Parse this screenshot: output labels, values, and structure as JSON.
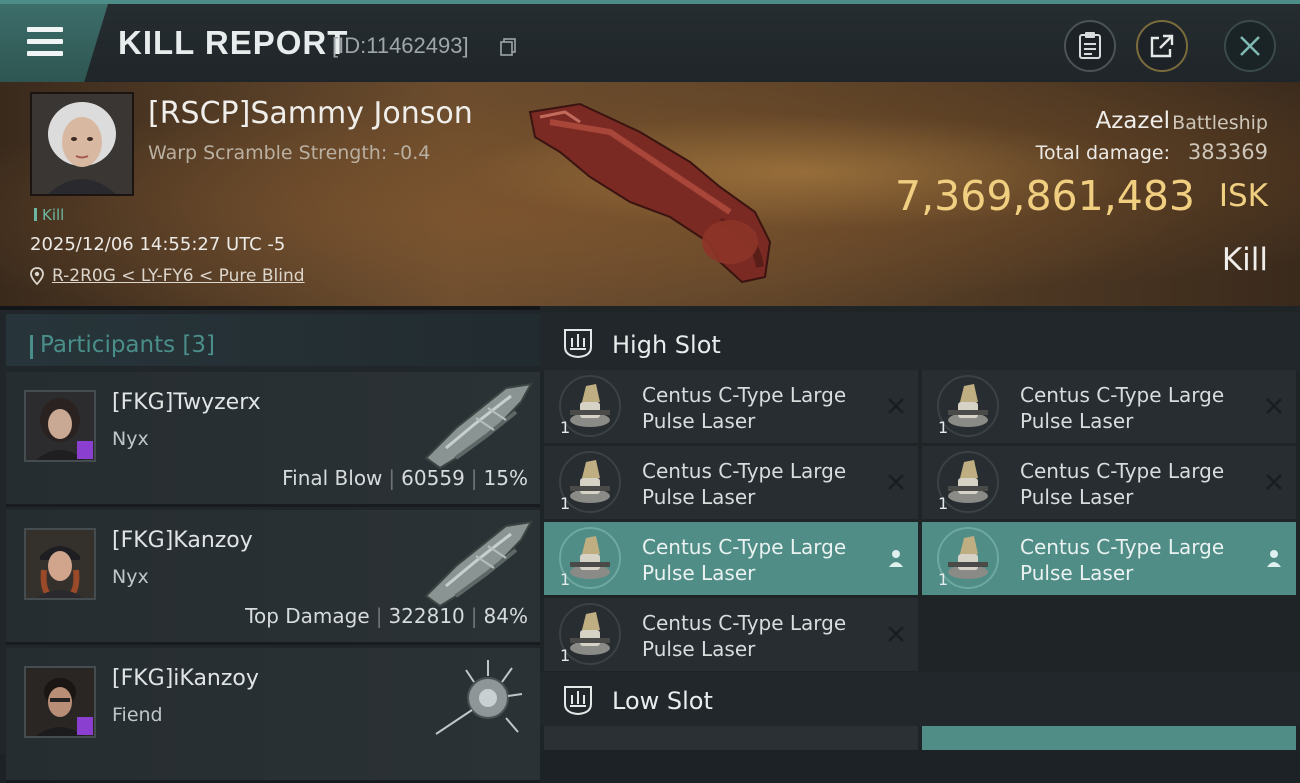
{
  "header": {
    "title": "KILL REPORT",
    "report_id": "[ID:11462493]"
  },
  "victim": {
    "name": "[RSCP]Sammy Jonson",
    "warp_scramble": "Warp Scramble Strength: -0.4",
    "tag": "Kill",
    "time": "2025/12/06 14:55:27 UTC -5",
    "location": "R-2R0G < LY-FY6 < Pure Blind"
  },
  "ship": {
    "name": "Azazel",
    "class": "Battleship",
    "total_damage_label": "Total damage:",
    "total_damage": "383369",
    "isk_value": "7,369,861,483",
    "isk_unit": "ISK",
    "result": "Kill"
  },
  "participants": {
    "title": "Participants [3]",
    "items": [
      {
        "name": "[FKG]Twyzerx",
        "ship": "Nyx",
        "stat_label": "Final Blow",
        "damage": "60559",
        "percent": "15%",
        "badge": true
      },
      {
        "name": "[FKG]Kanzoy",
        "ship": "Nyx",
        "stat_label": "Top Damage",
        "damage": "322810",
        "percent": "84%",
        "badge": false
      },
      {
        "name": "[FKG]iKanzoy",
        "ship": "Fiend",
        "stat_label": "",
        "damage": "",
        "percent": "",
        "badge": true
      }
    ]
  },
  "fitting": {
    "high_slot_title": "High Slot",
    "low_slot_title": "Low Slot",
    "high_slot_modules": [
      {
        "line1": "Centus C-Type Large",
        "line2": "Pulse Laser",
        "qty": "1",
        "state": "destroyed"
      },
      {
        "line1": "Centus C-Type Large",
        "line2": "Pulse Laser",
        "qty": "1",
        "state": "destroyed"
      },
      {
        "line1": "Centus C-Type Large",
        "line2": "Pulse Laser",
        "qty": "1",
        "state": "destroyed"
      },
      {
        "line1": "Centus C-Type Large",
        "line2": "Pulse Laser",
        "qty": "1",
        "state": "destroyed"
      },
      {
        "line1": "Centus C-Type Large",
        "line2": "Pulse Laser",
        "qty": "1",
        "state": "dropped"
      },
      {
        "line1": "Centus C-Type Large",
        "line2": "Pulse Laser",
        "qty": "1",
        "state": "dropped"
      },
      {
        "line1": "Centus C-Type Large",
        "line2": "Pulse Laser",
        "qty": "1",
        "state": "destroyed"
      }
    ]
  },
  "colors": {
    "accent": "#4f8d86",
    "isk_gold": "#f1cf80",
    "badge_purple": "#8b3fd0"
  },
  "icons": [
    "menu-icon",
    "copy-icon",
    "clipboard-icon",
    "share-icon",
    "close-icon",
    "location-pin-icon",
    "high-slot-icon",
    "low-slot-icon",
    "destroyed-x-icon",
    "dropped-person-icon"
  ]
}
